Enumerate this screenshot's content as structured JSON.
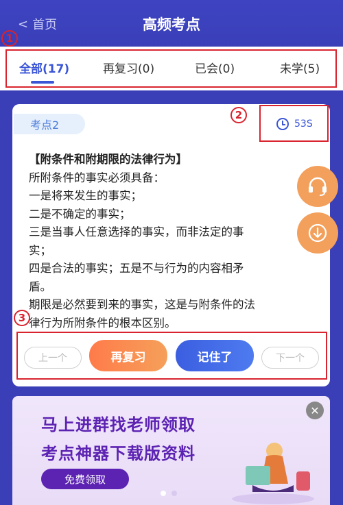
{
  "header": {
    "back_label": "首页",
    "title": "高频考点"
  },
  "tabs": [
    {
      "label": "全部(17)",
      "active": true
    },
    {
      "label": "再复习(0)"
    },
    {
      "label": "已会(0)"
    },
    {
      "label": "未学(5)"
    }
  ],
  "annotations": {
    "one": "1",
    "two": "2",
    "three": "3"
  },
  "card": {
    "tag": "考点2",
    "timer": "53S",
    "lines": [
      "【附条件和附期限的法律行为】",
      "所附条件的事实必须具备：",
      "一是将来发生的事实；",
      "二是不确定的事实；",
      "三是当事人任意选择的事实，而非法定的事",
      "实；",
      "四是合法的事实；五是不与行为的内容相矛",
      "盾。",
      "期限是必然要到来的事实，这是与附条件的法",
      "律行为所附条件的根本区别。"
    ],
    "buttons": {
      "prev": "上一个",
      "review": "再复习",
      "remember": "记住了",
      "next": "下一个"
    }
  },
  "banner": {
    "line1": "马上进群找老师领取",
    "line2": "考点神器下载版资料",
    "cta": "免费领取"
  },
  "colors": {
    "header_bg": "#3a3fb8",
    "accent_blue": "#3a55d6",
    "orange": "#f3a05d",
    "annotation_red": "#d9232e",
    "banner_purple": "#5c22b2"
  }
}
